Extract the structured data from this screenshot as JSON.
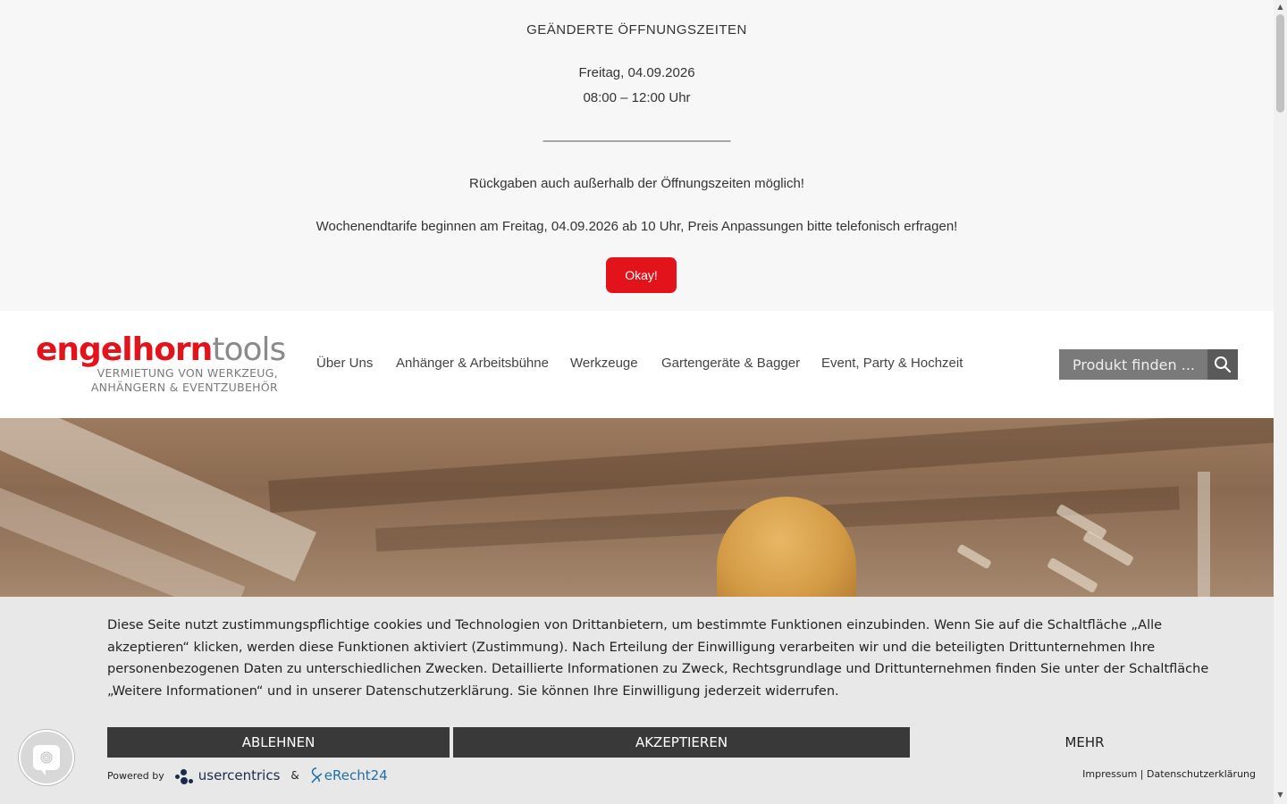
{
  "notice": {
    "title": "GEÄNDERTE ÖFFNUNGSZEITEN",
    "date": "Freitag, 04.09.2026",
    "hours": "08:00 – 12:00 Uhr",
    "separator": "——————————————",
    "returns": "Rückgaben auch außerhalb der Öffnungszeiten möglich!",
    "weekend": "Wochenendtarife beginnen am Freitag, 04.09.2026 ab 10 Uhr, Preis Anpassungen bitte telefonisch erfragen!",
    "okay_label": "Okay!"
  },
  "header": {
    "logo": {
      "part1": "engelhorn",
      "part2": "tools",
      "sub1": "VERMIETUNG VON WERKZEUG,",
      "sub2": "ANHÄNGERN & EVENTZUBEHÖR"
    },
    "nav": [
      {
        "label": "Über Uns"
      },
      {
        "label": "Anhänger & Arbeitsbühne"
      },
      {
        "label": "Werkzeuge"
      },
      {
        "label": "Gartengeräte & Bagger"
      },
      {
        "label": "Event, Party & Hochzeit"
      }
    ],
    "search": {
      "placeholder": "Produkt finden ...",
      "icon": "search-icon"
    }
  },
  "cookie": {
    "text": "Diese Seite nutzt zustimmungspflichtige cookies und Technologien von Drittanbietern, um bestimmte Funktionen einzubinden. Wenn Sie auf die Schaltfläche „Alle akzeptieren“ klicken, werden diese Funktionen aktiviert (Zustimmung). Nach Erteilung der Einwilligung verarbeiten wir und die beteiligten Drittunternehmen Ihre personenbezogenen Daten zu unterschiedlichen Zwecken. Detaillierte Informationen zu Zweck, Rechtsgrundlage und Drittunternehmen finden Sie unter der Schaltfläche „Weitere Informationen“ und in unserer Datenschutzerklärung. Sie können Ihre Einwilligung jederzeit widerrufen.",
    "decline_label": "ABLEHNEN",
    "accept_label": "AKZEPTIEREN",
    "more_label": "MEHR",
    "powered_by": "Powered by",
    "usercentrics": "usercentrics",
    "amp": "&",
    "erecht": "eRecht24",
    "impressum": "Impressum",
    "divider": "|",
    "privacy": "Datenschutzerklärung"
  },
  "colors": {
    "accent": "#e3131b",
    "cookie_button": "#393939",
    "search_bg": "#7a7a7a"
  }
}
